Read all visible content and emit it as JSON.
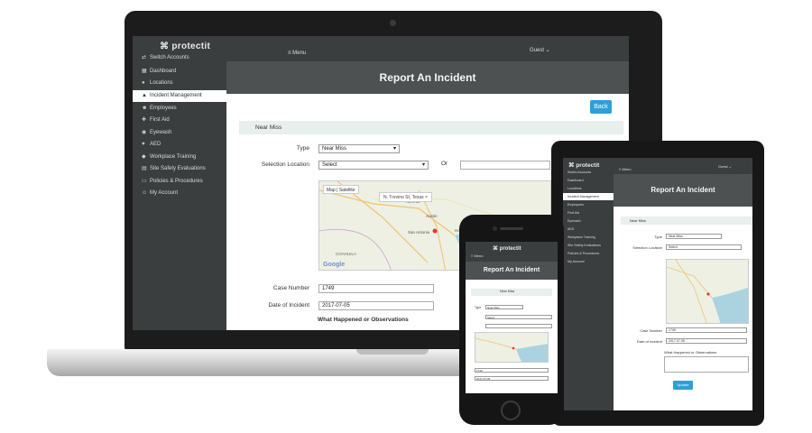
{
  "app": {
    "logo_text": "protectit",
    "menu_label": "Menu",
    "user_label": "Guest",
    "page_title": "Report An Incident"
  },
  "sidebar": {
    "items": [
      {
        "label": "Switch Accounts",
        "icon": "swap-icon"
      },
      {
        "label": "Dashboard",
        "icon": "dashboard-icon"
      },
      {
        "label": "Locations",
        "icon": "map-pin-icon"
      },
      {
        "label": "Incident Management",
        "icon": "warning-icon",
        "active": true
      },
      {
        "label": "Employees",
        "icon": "users-icon"
      },
      {
        "label": "First Aid",
        "icon": "first-aid-icon"
      },
      {
        "label": "Eyewash",
        "icon": "eye-icon"
      },
      {
        "label": "AED",
        "icon": "heart-icon"
      },
      {
        "label": "Workplace Training",
        "icon": "training-icon"
      },
      {
        "label": "Site Safety Evaluations",
        "icon": "clipboard-icon"
      },
      {
        "label": "Policies & Procedures",
        "icon": "document-icon"
      },
      {
        "label": "My Account",
        "icon": "user-icon"
      }
    ]
  },
  "form": {
    "back_label": "Back",
    "section_title": "Near Miss",
    "type_label": "Type",
    "type_value": "Near Miss",
    "location_label": "Selection Location",
    "location_value": "Select",
    "or_label": "Or",
    "case_number_label": "Case Number",
    "case_number_value": "1749",
    "date_label": "Date of Incident",
    "date_value": "2017-07-05",
    "happened_label": "What Happened or Observations",
    "update_label": "Update"
  },
  "map": {
    "tab_map": "Map",
    "tab_satellite": "Satellite",
    "info_text": "N. Trevino St, Texas",
    "google_label": "Google",
    "places": [
      "TEXAS",
      "Austin",
      "San Antonio",
      "Houston",
      "COAHUILA"
    ]
  },
  "colors": {
    "sidebar_bg": "#3b3e3f",
    "header_bg": "#4d5152",
    "accent": "#2f9fd6",
    "section_bg": "#e8efec"
  }
}
